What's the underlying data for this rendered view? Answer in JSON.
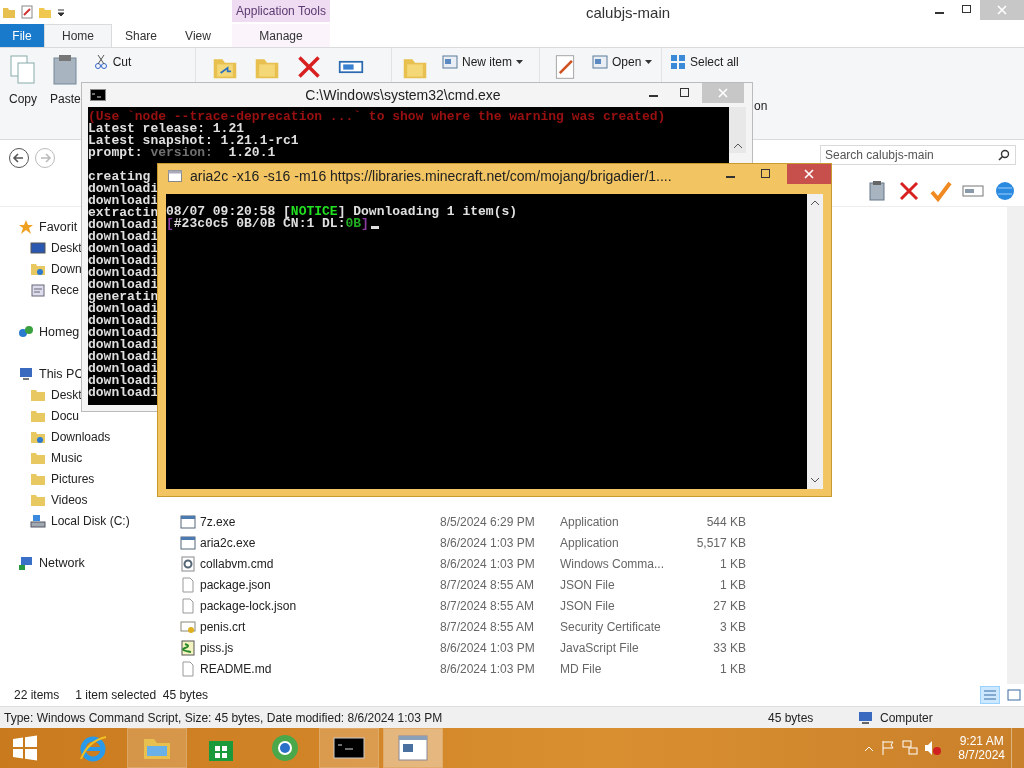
{
  "explorer": {
    "title": "calubjs-main",
    "contextual_group": "Application Tools",
    "ribbon_tabs": [
      {
        "label": "File",
        "kind": "file",
        "selected": false
      },
      {
        "label": "Home",
        "kind": "tab",
        "selected": true
      },
      {
        "label": "Share",
        "kind": "tab",
        "selected": false
      },
      {
        "label": "View",
        "kind": "tab",
        "selected": false
      },
      {
        "label": "Manage",
        "kind": "contextual",
        "selected": false
      }
    ],
    "ribbon_groups": [
      {
        "items": [
          {
            "kind": "large",
            "label": "Copy"
          },
          {
            "kind": "large",
            "label": "Paste"
          },
          {
            "kind": "small",
            "label": "Cut"
          }
        ]
      },
      {
        "items": [
          {
            "kind": "icon"
          },
          {
            "kind": "icon"
          },
          {
            "kind": "icon"
          },
          {
            "kind": "icon"
          }
        ]
      },
      {
        "items": [
          {
            "kind": "icon"
          },
          {
            "kind": "small",
            "label": "New item",
            "dropdown": true
          }
        ]
      },
      {
        "items": [
          {
            "kind": "icon"
          },
          {
            "kind": "small",
            "label": "Open",
            "dropdown": true
          }
        ]
      },
      {
        "items": [
          {
            "kind": "small",
            "label": "Select all"
          },
          {
            "kind": "fragment",
            "label": "on"
          }
        ]
      }
    ],
    "search": {
      "placeholder": "Search calubjs-main"
    },
    "nav": [
      {
        "label": "Favorit",
        "kind": "star",
        "children": [
          {
            "label": "Deskt",
            "kind": "desktop"
          },
          {
            "label": "Down",
            "kind": "downloads"
          },
          {
            "label": "Rece",
            "kind": "recent"
          }
        ]
      },
      {
        "label": "Homeg",
        "kind": "homegroup"
      },
      {
        "label": "This PC",
        "kind": "pc",
        "children": [
          {
            "label": "Deskt",
            "kind": "folder"
          },
          {
            "label": "Docu",
            "kind": "folder"
          },
          {
            "label": "Downloads",
            "kind": "downloads"
          },
          {
            "label": "Music",
            "kind": "folder"
          },
          {
            "label": "Pictures",
            "kind": "folder"
          },
          {
            "label": "Videos",
            "kind": "folder"
          },
          {
            "label": "Local Disk (C:)",
            "kind": "disk"
          }
        ]
      },
      {
        "label": "Network",
        "kind": "network"
      }
    ],
    "files": [
      {
        "name": "7z.exe",
        "kind": "exe",
        "date": "8/5/2024 6:29 PM",
        "type": "Application",
        "size": "544 KB"
      },
      {
        "name": "aria2c.exe",
        "kind": "exe",
        "date": "8/6/2024 1:03 PM",
        "type": "Application",
        "size": "5,517 KB"
      },
      {
        "name": "collabvm.cmd",
        "kind": "cmd",
        "date": "8/6/2024 1:03 PM",
        "type": "Windows Comma...",
        "size": "1 KB"
      },
      {
        "name": "package.json",
        "kind": "file",
        "date": "8/7/2024 8:55 AM",
        "type": "JSON File",
        "size": "1 KB"
      },
      {
        "name": "package-lock.json",
        "kind": "file",
        "date": "8/7/2024 8:55 AM",
        "type": "JSON File",
        "size": "27 KB"
      },
      {
        "name": "penis.crt",
        "kind": "cert",
        "date": "8/7/2024 8:55 AM",
        "type": "Security Certificate",
        "size": "3 KB"
      },
      {
        "name": "piss.js",
        "kind": "js",
        "date": "8/6/2024 1:03 PM",
        "type": "JavaScript File",
        "size": "33 KB"
      },
      {
        "name": "README.md",
        "kind": "file",
        "date": "8/6/2024 1:03 PM",
        "type": "MD File",
        "size": "1 KB"
      }
    ],
    "status": {
      "count": "22 items",
      "selection": "1 item selected  45 bytes"
    },
    "details_bar": {
      "text": "Type: Windows Command Script, Size: 45 bytes, Date modified: 8/6/2024 1:03 PM",
      "size": "45 bytes",
      "location": "Computer"
    }
  },
  "cmd_window": {
    "title": "C:\\Windows\\system32\\cmd.exe",
    "lines": [
      {
        "segments": [
          {
            "text": "(Use `node --trace-deprecation ...` to show where the warning was created)",
            "color": "#9a1010"
          }
        ]
      },
      {
        "segments": [
          {
            "text": "Latest release: 1.21",
            "color": "#e0e0e0"
          }
        ]
      },
      {
        "segments": [
          {
            "text": "Latest snapshot: 1.21.1-rc1",
            "color": "#e0e0e0"
          }
        ]
      },
      {
        "segments": [
          {
            "text": "prompt: ",
            "color": "#e0e0e0"
          },
          {
            "text": "version:",
            "color": "#707070"
          },
          {
            "text": "  1.20.1",
            "color": "#e0e0e0"
          }
        ]
      },
      {
        "gap_before": true,
        "segments": [
          {
            "text": "creating",
            "color": "#e0e0e0"
          }
        ]
      },
      {
        "segments": [
          {
            "text": "downloadi",
            "color": "#e0e0e0"
          }
        ]
      },
      {
        "segments": [
          {
            "text": "downloadi",
            "color": "#e0e0e0"
          }
        ]
      },
      {
        "segments": [
          {
            "text": "extractin",
            "color": "#e0e0e0"
          }
        ]
      },
      {
        "segments": [
          {
            "text": "downloadi",
            "color": "#e0e0e0"
          }
        ]
      },
      {
        "segments": [
          {
            "text": "downloadi",
            "color": "#e0e0e0"
          }
        ]
      },
      {
        "segments": [
          {
            "text": "downloadi",
            "color": "#e0e0e0"
          }
        ]
      },
      {
        "segments": [
          {
            "text": "downloadi",
            "color": "#e0e0e0"
          }
        ]
      },
      {
        "segments": [
          {
            "text": "downloadi",
            "color": "#e0e0e0"
          }
        ]
      },
      {
        "segments": [
          {
            "text": "downloadi",
            "color": "#e0e0e0"
          }
        ]
      },
      {
        "segments": [
          {
            "text": "generatin",
            "color": "#e0e0e0"
          }
        ]
      },
      {
        "segments": [
          {
            "text": "downloadi",
            "color": "#e0e0e0"
          }
        ]
      },
      {
        "segments": [
          {
            "text": "downloadi",
            "color": "#e0e0e0"
          }
        ]
      },
      {
        "segments": [
          {
            "text": "downloadi",
            "color": "#e0e0e0"
          }
        ]
      },
      {
        "segments": [
          {
            "text": "downloadi",
            "color": "#e0e0e0"
          }
        ]
      },
      {
        "segments": [
          {
            "text": "downloadi",
            "color": "#e0e0e0"
          }
        ]
      },
      {
        "segments": [
          {
            "text": "downloadi",
            "color": "#e0e0e0"
          }
        ]
      },
      {
        "segments": [
          {
            "text": "downloadi",
            "color": "#e0e0e0"
          }
        ]
      },
      {
        "segments": [
          {
            "text": "downloadi",
            "color": "#e0e0e0"
          }
        ]
      }
    ]
  },
  "aria_window": {
    "title": "aria2c  -x16 -s16 -m16 https://libraries.minecraft.net/com/mojang/brigadier/1....",
    "lines": [
      {
        "segments": [
          {
            "text": "08/07 09:20:58 [",
            "color": "#e0e0e0"
          },
          {
            "text": "NOTICE",
            "color": "#22e022"
          },
          {
            "text": "] Downloading 1 item(s)",
            "color": "#e0e0e0"
          }
        ]
      },
      {
        "cursor": true,
        "segments": [
          {
            "text": "[",
            "color": "#8a3aa0"
          },
          {
            "text": "#23c0c5 0B/0B CN:1 DL:",
            "color": "#e0e0e0"
          },
          {
            "text": "0B",
            "color": "#22b022"
          },
          {
            "text": "]",
            "color": "#8a3aa0"
          }
        ]
      }
    ]
  },
  "taskbar": {
    "apps": [
      {
        "kind": "ie",
        "open": false,
        "selected": false
      },
      {
        "kind": "explorer",
        "open": true,
        "selected": false
      },
      {
        "kind": "store",
        "open": false,
        "selected": false
      },
      {
        "kind": "chrome",
        "open": false,
        "selected": false
      },
      {
        "kind": "cmd",
        "open": true,
        "selected": false
      },
      {
        "kind": "console",
        "open": true,
        "selected": true
      }
    ],
    "time": "9:21 AM",
    "date": "8/7/2024"
  }
}
